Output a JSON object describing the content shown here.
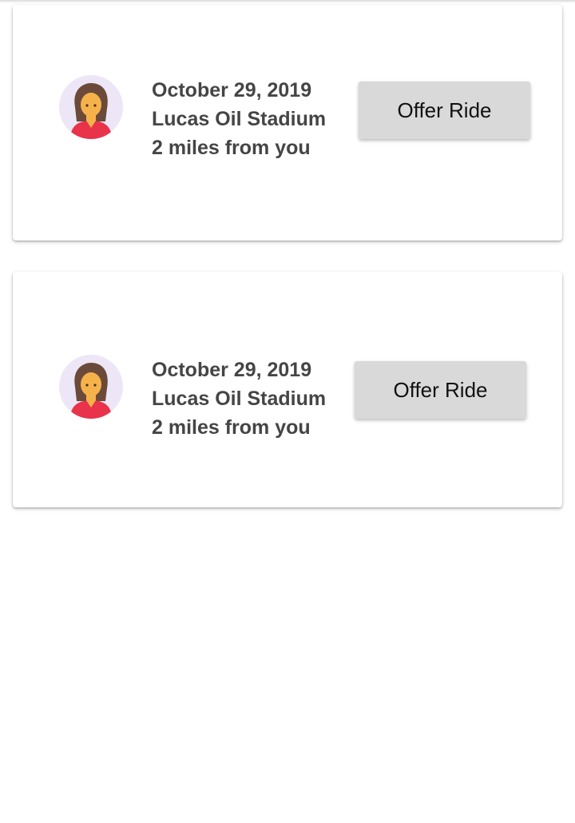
{
  "rides": [
    {
      "date": "October 29, 2019",
      "venue": "Lucas Oil Stadium",
      "distance": "2 miles from you",
      "button_label": "Offer Ride",
      "avatar_icon": "woman-avatar-icon"
    },
    {
      "date": "October 29, 2019",
      "venue": "Lucas Oil Stadium",
      "distance": "2 miles from you",
      "button_label": "Offer Ride",
      "avatar_icon": "woman-avatar-icon"
    }
  ],
  "colors": {
    "avatar_bg": "#ece6f6",
    "hair": "#6b4a3a",
    "skin": "#f6b24a",
    "shirt": "#e8334a",
    "button_bg": "#d9d9d9",
    "text": "#454545"
  }
}
